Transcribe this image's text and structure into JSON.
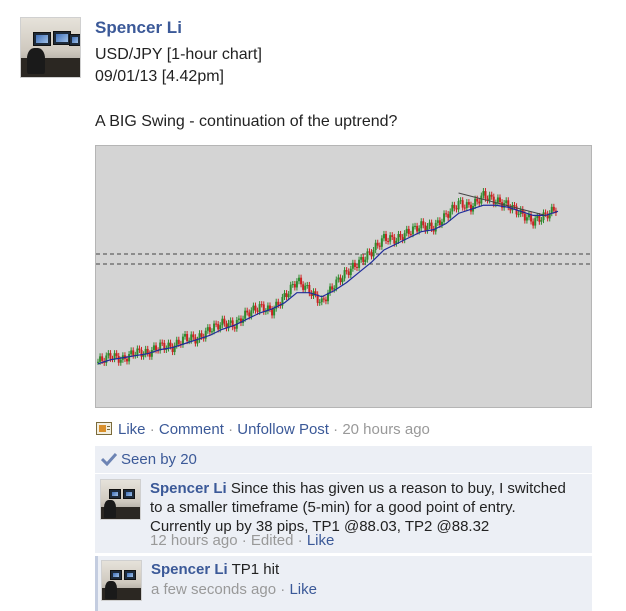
{
  "post": {
    "author": "Spencer Li",
    "lines": [
      "USD/JPY [1-hour chart]",
      "09/01/13 [4.42pm]",
      "A BIG Swing - continuation of the uptrend?"
    ]
  },
  "chart_data": {
    "type": "line",
    "title": "",
    "series": [
      {
        "values": [
          6,
          9,
          7,
          11,
          10,
          14,
          13,
          18,
          17,
          22,
          25,
          24,
          30,
          33,
          31,
          38,
          46,
          41,
          35,
          44,
          50,
          55,
          60,
          67,
          66,
          70,
          73,
          72,
          78,
          84,
          82,
          88,
          85,
          83,
          79,
          75,
          78,
          82
        ]
      },
      {
        "values": [
          5,
          7,
          8,
          9,
          10,
          12,
          13,
          15,
          17,
          19,
          22,
          24,
          27,
          30,
          32,
          35,
          40,
          40,
          38,
          41,
          45,
          50,
          55,
          61,
          64,
          67,
          70,
          71,
          74,
          79,
          81,
          83,
          83,
          82,
          80,
          78,
          78,
          80
        ]
      }
    ],
    "colors": {
      "price": "#2e8b2e",
      "bearish": "#cc2222",
      "moving_average": "#1f2b9a",
      "background": "#d4d4d4",
      "support_lines": "#444444"
    },
    "horizontal_lines": 2,
    "grid": false
  },
  "actions": {
    "like": "Like",
    "sep": " · ",
    "comment": "Comment",
    "unfollow": "Unfollow Post",
    "time": "20 hours ago"
  },
  "seen": "Seen by 20",
  "comments": [
    {
      "author": "Spencer Li",
      "text": "Since this has given us a reason to buy, I switched to a smaller timeframe (5-min) for a good point of entry. Currently up by 38 pips, TP1 @88.03, TP2 @88.32",
      "time": "12 hours ago",
      "edited": "Edited",
      "like": "Like"
    },
    {
      "author": "Spencer Li",
      "text": "TP1 hit",
      "time": "a few seconds ago",
      "like": "Like"
    }
  ]
}
